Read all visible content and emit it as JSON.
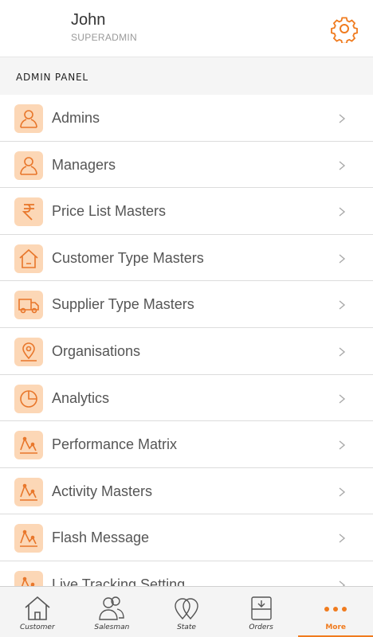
{
  "profile": {
    "name": "John",
    "role": "SUPERADMIN"
  },
  "section": {
    "title": "ADMIN PANEL"
  },
  "menu": [
    {
      "label": "Admins",
      "icon": "person-icon"
    },
    {
      "label": "Managers",
      "icon": "person-icon"
    },
    {
      "label": "Price List Masters",
      "icon": "rupee-icon"
    },
    {
      "label": "Customer Type Masters",
      "icon": "house-icon"
    },
    {
      "label": "Supplier Type Masters",
      "icon": "truck-icon"
    },
    {
      "label": "Organisations",
      "icon": "location-pin-icon"
    },
    {
      "label": "Analytics",
      "icon": "pie-chart-icon"
    },
    {
      "label": "Performance Matrix",
      "icon": "line-graph-icon"
    },
    {
      "label": "Activity Masters",
      "icon": "line-graph-icon"
    },
    {
      "label": "Flash Message",
      "icon": "line-graph-icon"
    },
    {
      "label": "Live Tracking Setting",
      "icon": "line-graph-icon"
    }
  ],
  "tabs": [
    {
      "label": "Customer",
      "icon": "house-icon"
    },
    {
      "label": "Salesman",
      "icon": "people-icon"
    },
    {
      "label": "State",
      "icon": "map-pins-icon"
    },
    {
      "label": "Orders",
      "icon": "inbox-icon"
    },
    {
      "label": "More",
      "icon": "more-dots-icon",
      "active": true
    }
  ],
  "colors": {
    "accent": "#f07b1e",
    "icon_bg": "#fcd7b6"
  }
}
